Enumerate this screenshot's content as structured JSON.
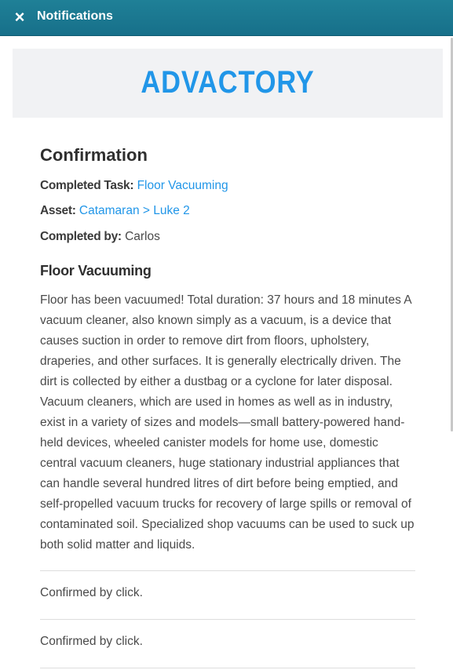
{
  "header": {
    "close_icon": "×",
    "title": "Notifications"
  },
  "brand": {
    "logo_text": "ADVACTORY",
    "accent_color": "#2196e8"
  },
  "confirmation": {
    "heading": "Confirmation",
    "completed_task_label": "Completed Task:",
    "completed_task_value": "Floor Vacuuming",
    "asset_label": "Asset:",
    "asset_value": "Catamaran > Luke 2",
    "completed_by_label": "Completed by:",
    "completed_by_value": "Carlos"
  },
  "task": {
    "title": "Floor Vacuuming",
    "description": "Floor has been vacuumed! Total duration: 37 hours and 18 minutes A vacuum cleaner, also known simply as a vacuum, is a device that causes suction in order to remove dirt from floors, upholstery, draperies, and other surfaces. It is generally electrically driven. The dirt is collected by either a dustbag or a cyclone for later disposal. Vacuum cleaners, which are used in homes as well as in industry, exist in a variety of sizes and models—small battery-powered hand-held devices, wheeled canister models for home use, domestic central vacuum cleaners, huge stationary industrial appliances that can handle several hundred litres of dirt before being emptied, and self-propelled vacuum trucks for recovery of large spills or removal of contaminated soil. Specialized shop vacuums can be used to suck up both solid matter and liquids."
  },
  "confirmations": [
    {
      "text": "Confirmed by click."
    },
    {
      "text": "Confirmed by click."
    }
  ]
}
